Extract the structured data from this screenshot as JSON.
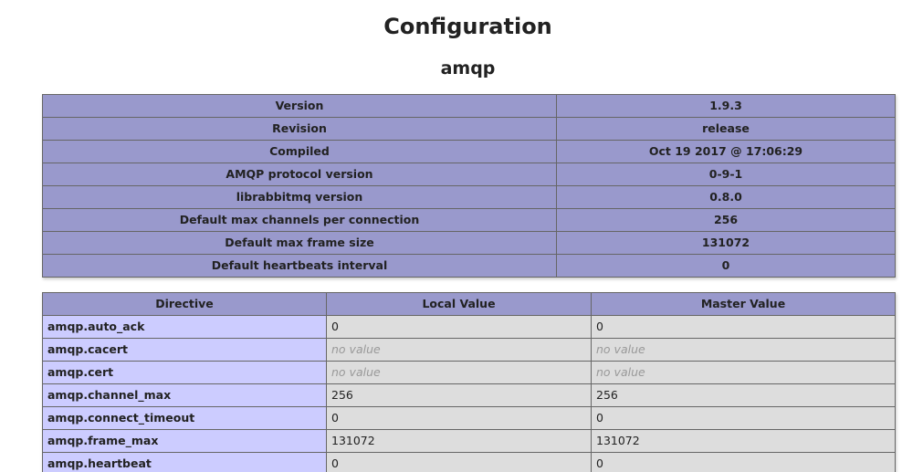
{
  "page": {
    "title": "Configuration",
    "section": "amqp"
  },
  "info_rows": [
    {
      "label": "Version",
      "value": "1.9.3"
    },
    {
      "label": "Revision",
      "value": "release"
    },
    {
      "label": "Compiled",
      "value": "Oct 19 2017 @ 17:06:29"
    },
    {
      "label": "AMQP protocol version",
      "value": "0-9-1"
    },
    {
      "label": "librabbitmq version",
      "value": "0.8.0"
    },
    {
      "label": "Default max channels per connection",
      "value": "256"
    },
    {
      "label": "Default max frame size",
      "value": "131072"
    },
    {
      "label": "Default heartbeats interval",
      "value": "0"
    }
  ],
  "directives": {
    "headers": {
      "directive": "Directive",
      "local": "Local Value",
      "master": "Master Value"
    },
    "rows": [
      {
        "name": "amqp.auto_ack",
        "local": "0",
        "master": "0"
      },
      {
        "name": "amqp.cacert",
        "local": "no value",
        "master": "no value"
      },
      {
        "name": "amqp.cert",
        "local": "no value",
        "master": "no value"
      },
      {
        "name": "amqp.channel_max",
        "local": "256",
        "master": "256"
      },
      {
        "name": "amqp.connect_timeout",
        "local": "0",
        "master": "0"
      },
      {
        "name": "amqp.frame_max",
        "local": "131072",
        "master": "131072"
      },
      {
        "name": "amqp.heartbeat",
        "local": "0",
        "master": "0"
      }
    ]
  },
  "colors": {
    "header_bg": "#9999cc",
    "label_bg": "#ccccff",
    "value_bg": "#dddddd",
    "no_value": "#999999"
  }
}
